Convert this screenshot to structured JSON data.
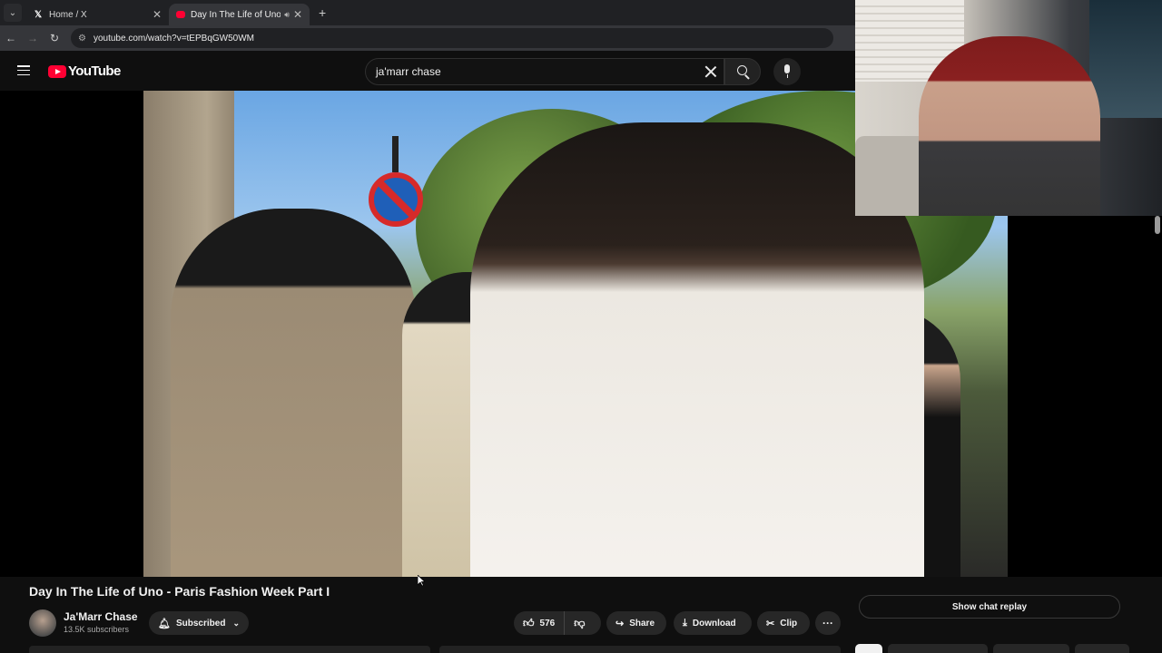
{
  "browser": {
    "tabs": [
      {
        "label": "Home / X",
        "favicon": "x-logo-icon"
      },
      {
        "label": "Day In The Life of Uno - Pa",
        "favicon": "youtube-icon",
        "audio": true
      }
    ],
    "new_tab_symbol": "+",
    "url": "youtube.com/watch?v=tEPBqGW50WM"
  },
  "youtube": {
    "logo_text": "YouTube",
    "search": {
      "value": "ja'marr chase"
    },
    "video": {
      "title": "Day In The Life of Uno - Paris Fashion Week Part I",
      "channel": "Ja'Marr Chase",
      "subscribers": "13.5K subscribers",
      "subscribe_label": "Subscribed",
      "likes": "576",
      "share_label": "Share",
      "download_label": "Download",
      "clip_label": "Clip",
      "more_symbol": "···"
    },
    "chat_replay_label": "Show chat replay"
  },
  "colors": {
    "background": "#0f0f0f",
    "brand_red": "#ff0033",
    "pill_bg": "#272727",
    "text_primary": "#f1f1f1",
    "text_secondary": "#aaaaaa"
  }
}
